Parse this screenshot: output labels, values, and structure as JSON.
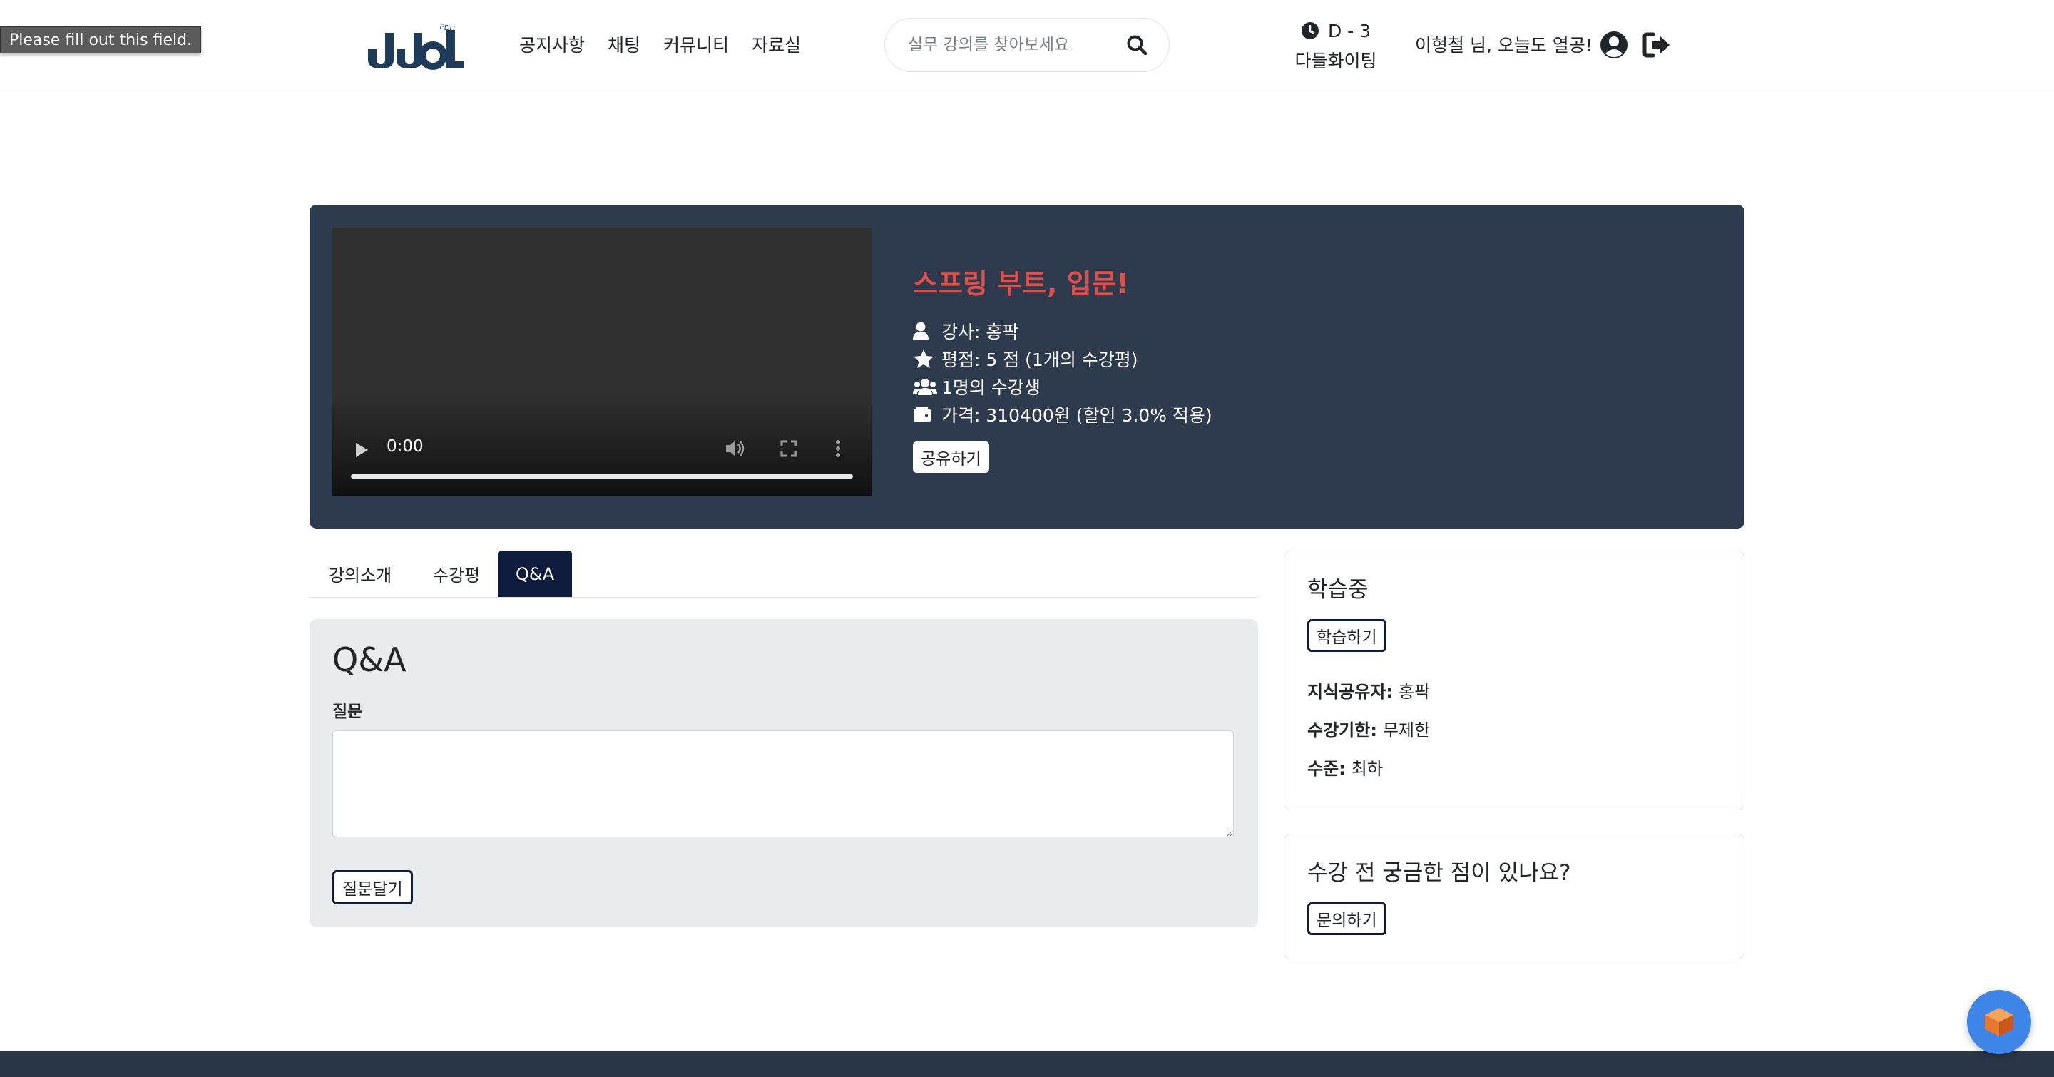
{
  "tooltip": {
    "text": "Please fill out this field."
  },
  "header": {
    "nav": [
      "공지사항",
      "채팅",
      "커뮤니티",
      "자료실"
    ],
    "search": {
      "placeholder": "실무 강의를 찾아보세요",
      "value": ""
    },
    "dday": {
      "label": "D - 3",
      "event": "다들화이팅"
    },
    "greeting": "이형철 님, 오늘도 열공!"
  },
  "course": {
    "title": "스프링 부트, 입문!",
    "instructor": "강사: 홍팍",
    "rating": "평점: 5 점 (1개의 수강평)",
    "students": "1명의 수강생",
    "price": "가격: 310400원 (할인 3.0% 적용)",
    "share_label": "공유하기",
    "video": {
      "time": "0:00",
      "progress": 0
    }
  },
  "tabs": {
    "items": [
      "강의소개",
      "수강평",
      "Q&A"
    ],
    "active": "Q&A"
  },
  "qna": {
    "title": "Q&A",
    "question_label": "질문",
    "question_value": "",
    "submit_label": "질문달기"
  },
  "sidebar": {
    "status": {
      "title": "학습중",
      "button": "학습하기",
      "rows": [
        {
          "label": "지식공유자:",
          "value": "홍팍"
        },
        {
          "label": "수강기한:",
          "value": "무제한"
        },
        {
          "label": "수준:",
          "value": "최하"
        }
      ]
    },
    "inquiry": {
      "title": "수강 전 궁금한 점이 있나요?",
      "button": "문의하기"
    }
  },
  "colors": {
    "hero_bg": "#2e3a4e",
    "title_accent": "#e0504a",
    "active_tab": "#0f1b3d",
    "brand": "#1f3b5a",
    "fab": "#3d86e8"
  },
  "icons": [
    "clock-icon",
    "search-icon",
    "user-circle-icon",
    "logout-icon",
    "user-icon",
    "star-icon",
    "users-icon",
    "wallet-icon",
    "play-icon",
    "volume-icon",
    "fullscreen-icon",
    "more-icon",
    "cube-icon"
  ]
}
